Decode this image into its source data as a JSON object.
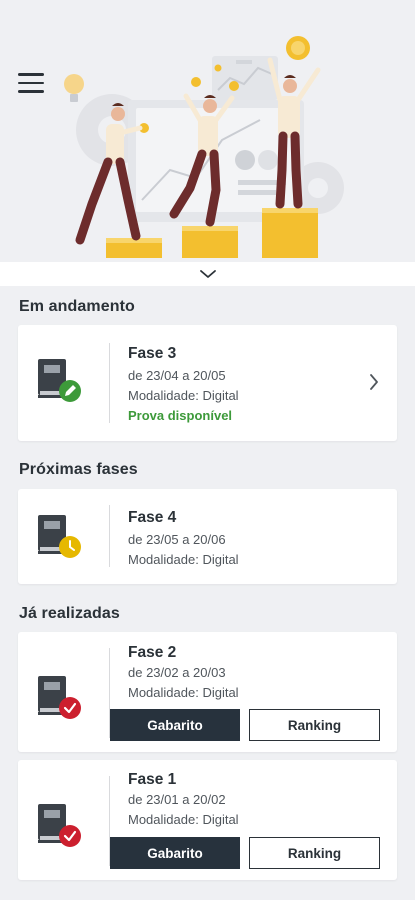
{
  "header": {
    "menu_icon": "hamburger-menu-icon",
    "expand_icon": "chevron-down-icon"
  },
  "sections": {
    "in_progress": "Em andamento",
    "upcoming": "Próximas fases",
    "done": "Já realizadas"
  },
  "cards": {
    "fase3": {
      "title": "Fase 3",
      "dates": "de 23/04 a 20/05",
      "mode": "Modalidade: Digital",
      "status": "Prova disponível",
      "badge": "pencil-icon"
    },
    "fase4": {
      "title": "Fase 4",
      "dates": "de 23/05 a 20/06",
      "mode": "Modalidade: Digital",
      "badge": "clock-icon"
    },
    "fase2": {
      "title": "Fase 2",
      "dates": "de 23/02 a 20/03",
      "mode": "Modalidade: Digital",
      "btn_primary": "Gabarito",
      "btn_secondary": "Ranking",
      "badge": "check-icon"
    },
    "fase1": {
      "title": "Fase 1",
      "dates": "de 23/01 a 20/02",
      "mode": "Modalidade: Digital",
      "btn_primary": "Gabarito",
      "btn_secondary": "Ranking",
      "badge": "check-icon"
    }
  },
  "colors": {
    "dark": "#27323d",
    "green": "#3d9a3a",
    "yellow": "#e6b800",
    "red": "#cc1f2e",
    "background": "#eff0f3"
  }
}
